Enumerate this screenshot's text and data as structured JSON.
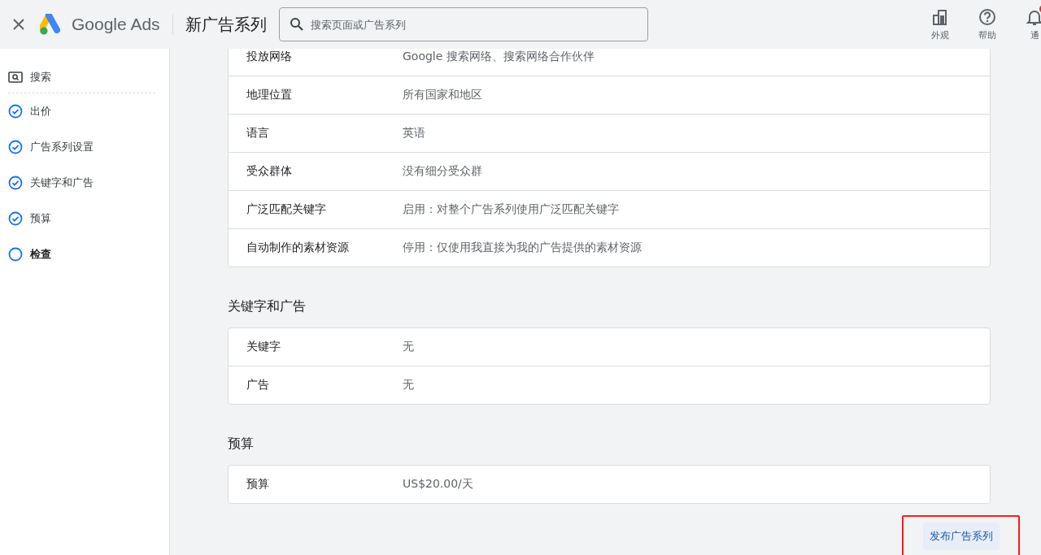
{
  "header": {
    "product": "Google Ads",
    "title": "新广告系列",
    "search": {
      "placeholder": "搜索页面或广告系列"
    },
    "actions": [
      {
        "kind": "appearance",
        "label": "外观"
      },
      {
        "kind": "help",
        "label": "帮助"
      },
      {
        "kind": "notifications",
        "label": "通",
        "badge": true
      }
    ]
  },
  "sidebar": {
    "items": [
      {
        "kind": "search",
        "label": "搜索"
      },
      {
        "kind": "step",
        "label": "出价",
        "done": true,
        "selected": false
      },
      {
        "kind": "step",
        "label": "广告系列设置",
        "done": true,
        "selected": false
      },
      {
        "kind": "step",
        "label": "关键字和广告",
        "done": true,
        "selected": false
      },
      {
        "kind": "step",
        "label": "预算",
        "done": true,
        "selected": false
      },
      {
        "kind": "step",
        "label": "检查",
        "done": false,
        "selected": true
      }
    ]
  },
  "sections": [
    {
      "rows": [
        {
          "label": "投放网络",
          "value": "Google 搜索网络、搜索网络合作伙伴"
        },
        {
          "label": "地理位置",
          "value": "所有国家和地区"
        },
        {
          "label": "语言",
          "value": "英语"
        },
        {
          "label": "受众群体",
          "value": "没有细分受众群"
        },
        {
          "label": "广泛匹配关键字",
          "value": "启用：对整个广告系列使用广泛匹配关键字"
        },
        {
          "label": "自动制作的素材资源",
          "value": "停用：仅使用我直接为我的广告提供的素材资源"
        }
      ]
    },
    {
      "title": "关键字和广告",
      "rows": [
        {
          "label": "关键字",
          "value": "无"
        },
        {
          "label": "广告",
          "value": "无"
        }
      ]
    },
    {
      "title": "预算",
      "rows": [
        {
          "label": "预算",
          "value": "US$20.00/天"
        }
      ]
    }
  ],
  "publish_button": {
    "label": "发布广告系列",
    "highlighted": true
  }
}
